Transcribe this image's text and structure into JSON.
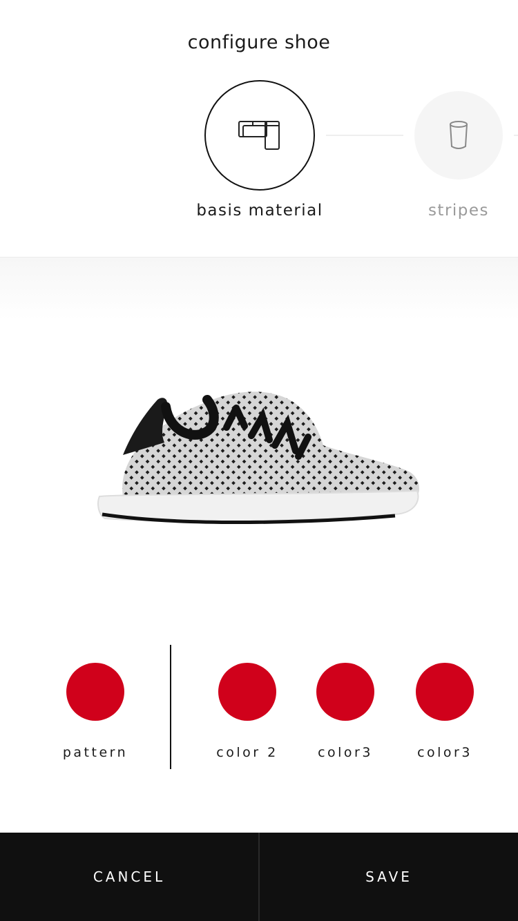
{
  "header": {
    "title": "configure shoe"
  },
  "steps": [
    {
      "label": "basis material",
      "icon": "fabric-layers-icon",
      "active": true
    },
    {
      "label": "stripes",
      "icon": "cup-icon",
      "active": false
    }
  ],
  "product": {
    "image_icon": "sneaker-image"
  },
  "options": {
    "pattern": {
      "label": "pattern",
      "color": "#D0011B"
    },
    "colors": [
      {
        "label": "color 2",
        "color": "#D0011B"
      },
      {
        "label": "color3",
        "color": "#D0011B"
      },
      {
        "label": "color3",
        "color": "#D0011B"
      }
    ]
  },
  "footer": {
    "cancel_label": "CANCEL",
    "save_label": "SAVE"
  },
  "theme": {
    "accent": "#D0011B",
    "footer_bg": "#101010"
  }
}
